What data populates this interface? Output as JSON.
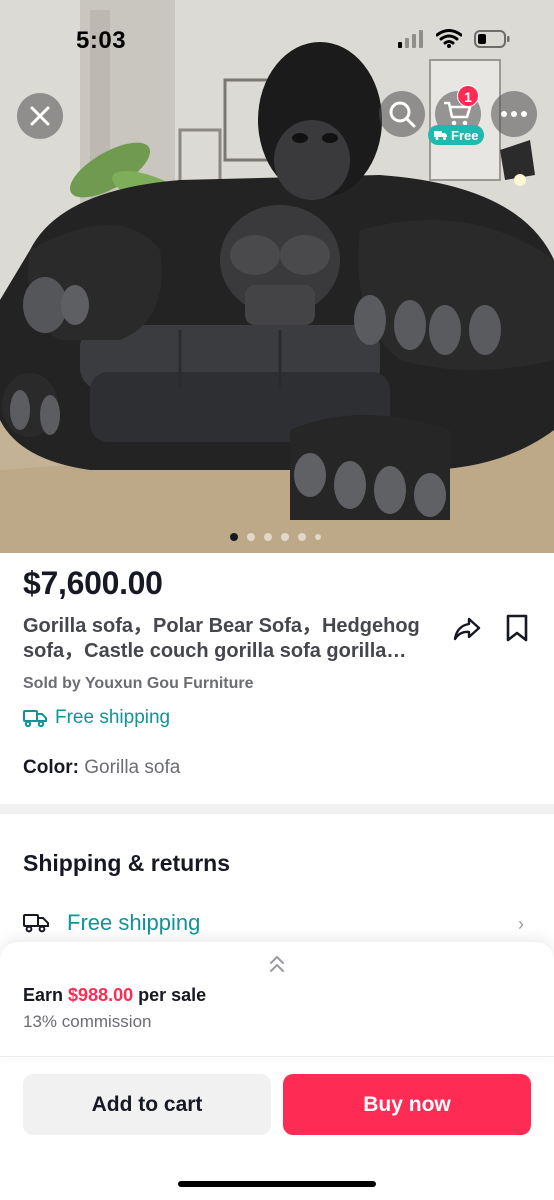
{
  "status_bar": {
    "time": "5:03"
  },
  "gallery": {
    "image_subject": "gorilla-sofa-photo",
    "total_images": 6,
    "active_index": 0
  },
  "header": {
    "cart_count": "1",
    "free_label": "Free"
  },
  "product": {
    "price": "$7,600.00",
    "title": "Gorilla sofa，Polar Bear Sofa，Hedgehog sofa，Castle couch gorilla sofa gorilla  couch",
    "sold_by": "Sold by Youxun Gou Furniture",
    "shipping": "Free shipping",
    "color_label": "Color:",
    "color_value": "Gorilla sofa"
  },
  "shipping_returns": {
    "heading": "Shipping & returns",
    "shipping_label": "Free shipping"
  },
  "earn": {
    "prefix": "Earn",
    "amount": "$988.00",
    "suffix": "per sale",
    "commission": "13% commission"
  },
  "actions": {
    "add_to_cart": "Add to cart",
    "buy_now": "Buy now"
  },
  "colors": {
    "accent": "#fe2c55",
    "teal": "#119496",
    "badge_teal": "#1fb9b0"
  }
}
